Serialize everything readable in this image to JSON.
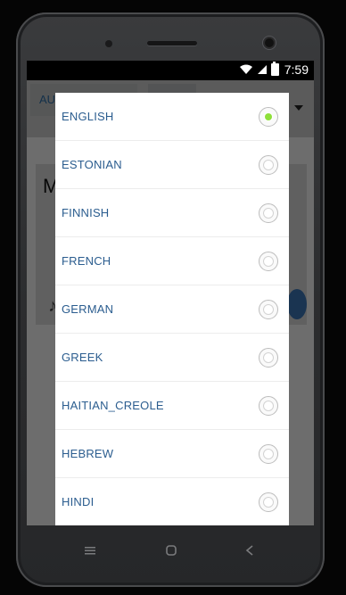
{
  "status_bar": {
    "time": "7:59"
  },
  "app": {
    "language_from": "AU",
    "title_initial": "M"
  },
  "language_dialog": {
    "selected": "ENGLISH",
    "options": [
      {
        "label": "ENGLISH",
        "checked": true
      },
      {
        "label": "ESTONIAN",
        "checked": false
      },
      {
        "label": "FINNISH",
        "checked": false
      },
      {
        "label": "FRENCH",
        "checked": false
      },
      {
        "label": "GERMAN",
        "checked": false
      },
      {
        "label": "GREEK",
        "checked": false
      },
      {
        "label": "HAITIAN_CREOLE",
        "checked": false
      },
      {
        "label": "HEBREW",
        "checked": false
      },
      {
        "label": "HINDI",
        "checked": false
      }
    ],
    "accent_color": "#8ee03a",
    "label_color": "#2b5d8f"
  },
  "nav_bar": {
    "icons": [
      "menu-icon",
      "home-icon",
      "back-icon"
    ]
  }
}
